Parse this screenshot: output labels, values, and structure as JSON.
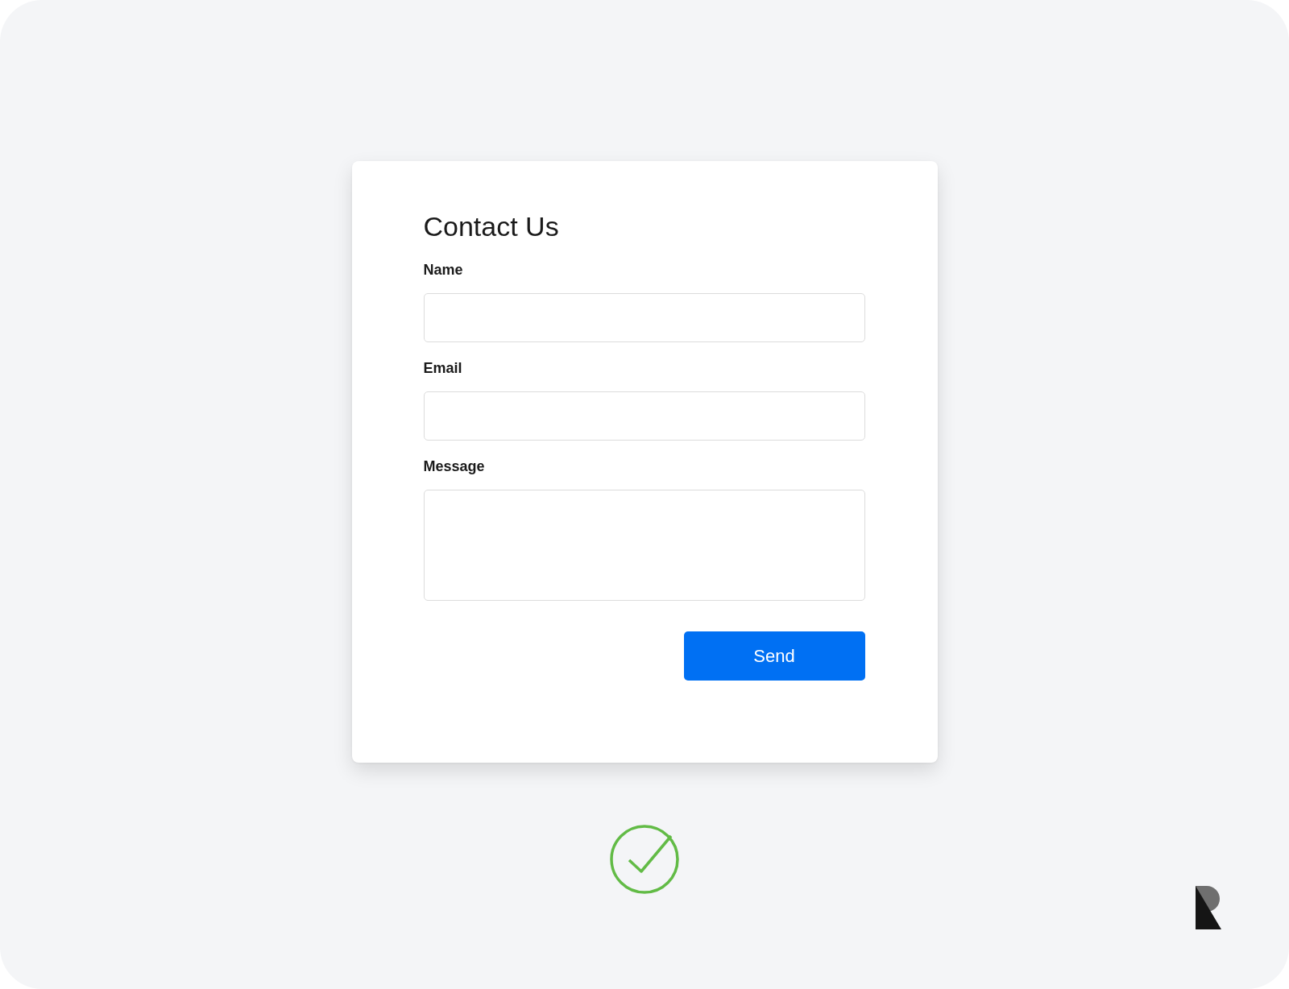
{
  "form": {
    "title": "Contact Us",
    "fields": [
      {
        "label": "Name",
        "kind": "input"
      },
      {
        "label": "Email",
        "kind": "input"
      },
      {
        "label": "Message",
        "kind": "textarea"
      }
    ],
    "submit": "Send"
  }
}
